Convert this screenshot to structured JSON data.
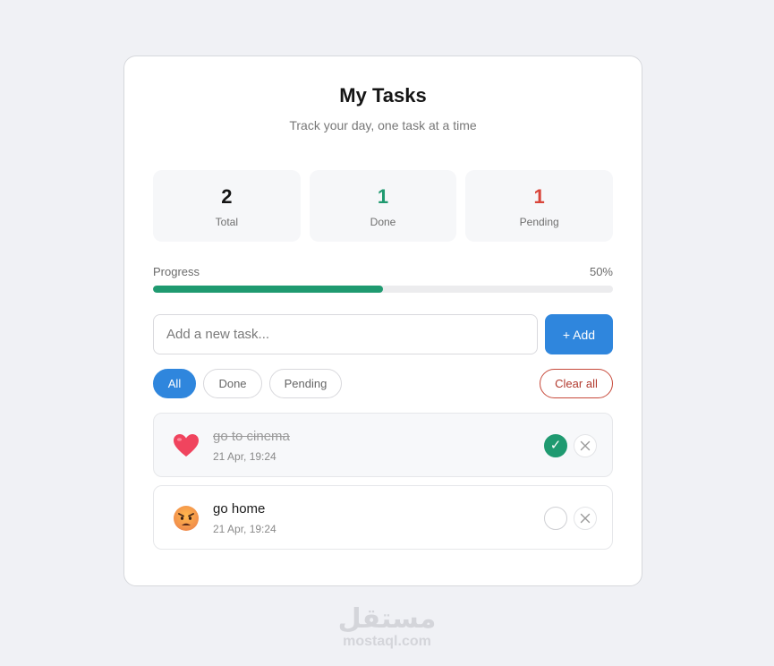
{
  "header": {
    "title": "My Tasks",
    "subtitle": "Track your day, one task at a time"
  },
  "stats": [
    {
      "value": "2",
      "label": "Total",
      "color": "#151515"
    },
    {
      "value": "1",
      "label": "Done",
      "color": "#1f9a70"
    },
    {
      "value": "1",
      "label": "Pending",
      "color": "#d9453a"
    }
  ],
  "progress": {
    "label": "Progress",
    "percent_text": "50%",
    "fraction": 0.5
  },
  "add_task": {
    "placeholder": "Add a new task...",
    "value": "",
    "button_label": "+ Add"
  },
  "filters": {
    "items": [
      {
        "label": "All",
        "active": true
      },
      {
        "label": "Done",
        "active": false
      },
      {
        "label": "Pending",
        "active": false
      }
    ],
    "clear_label": "Clear all"
  },
  "tasks": [
    {
      "text": "go to cinema",
      "time": "21 Apr, 19:24",
      "done": true,
      "emoji": "heart-icon",
      "check_glyph": "✓"
    },
    {
      "text": "go home",
      "time": "21 Apr, 19:24",
      "done": false,
      "emoji": "angry-face-icon",
      "check_glyph": ""
    }
  ],
  "watermark": {
    "logo": "مستقل",
    "url": "mostaql.com"
  },
  "colors": {
    "accent": "#2f86dd",
    "success": "#1f9a70",
    "danger": "#d9453a"
  }
}
